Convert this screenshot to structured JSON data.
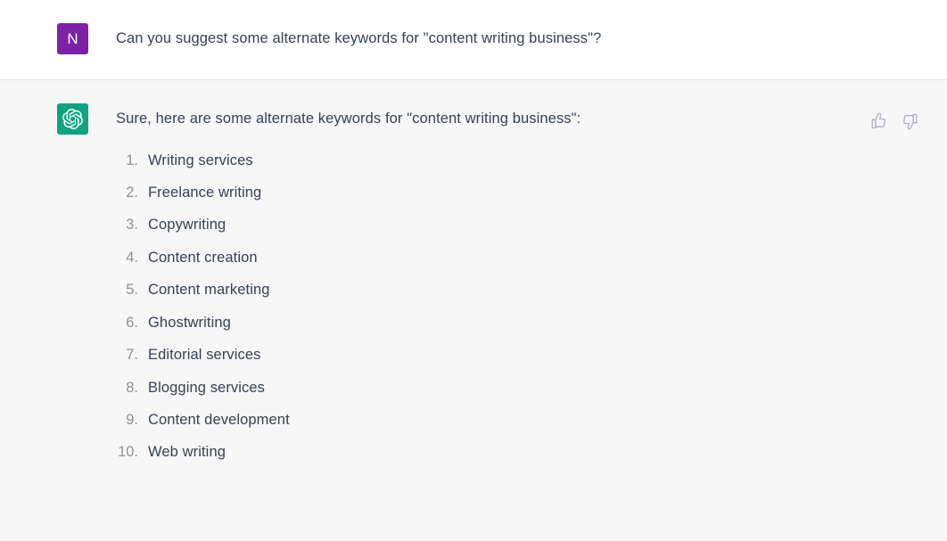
{
  "conversation": {
    "user_message": {
      "avatar_initial": "N",
      "avatar_color": "#7b22a6",
      "text": "Can you suggest some alternate keywords for \"content writing business\"?"
    },
    "assistant_message": {
      "avatar_color": "#10a37f",
      "avatar_icon": "openai-logo-icon",
      "text": "Sure, here are some alternate keywords for \"content writing business\":",
      "keywords": [
        {
          "number": "1.",
          "label": "Writing services"
        },
        {
          "number": "2.",
          "label": "Freelance writing"
        },
        {
          "number": "3.",
          "label": "Copywriting"
        },
        {
          "number": "4.",
          "label": "Content creation"
        },
        {
          "number": "5.",
          "label": "Content marketing"
        },
        {
          "number": "6.",
          "label": "Ghostwriting"
        },
        {
          "number": "7.",
          "label": "Editorial services"
        },
        {
          "number": "8.",
          "label": "Blogging services"
        },
        {
          "number": "9.",
          "label": "Content development"
        },
        {
          "number": "10.",
          "label": "Web writing"
        }
      ],
      "feedback": {
        "thumbs_up_icon": "thumbs-up-icon",
        "thumbs_down_icon": "thumbs-down-icon",
        "icon_color": "#aeb2c0"
      }
    }
  }
}
